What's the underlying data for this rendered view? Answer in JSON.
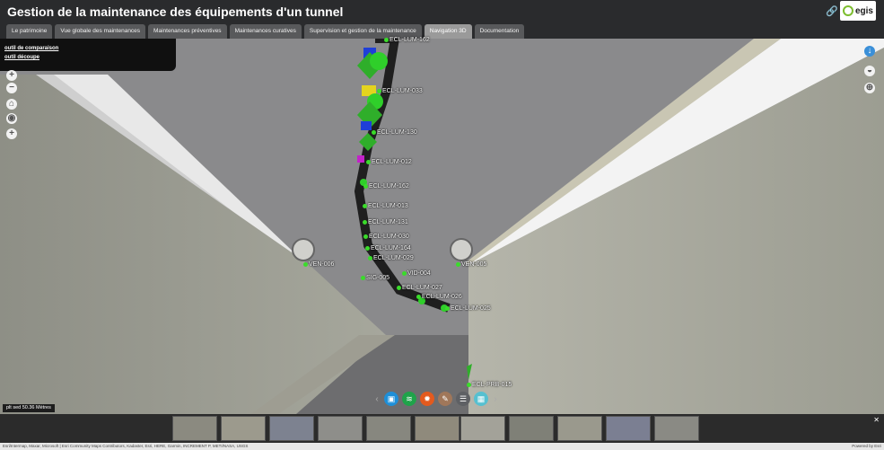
{
  "header": {
    "title": "Gestion de la maintenance des équipements d'un tunnel",
    "logo_text": "egis"
  },
  "tabs": [
    {
      "label": "Le patrimoine"
    },
    {
      "label": "Vue globale des maintenances"
    },
    {
      "label": "Maintenances préventives"
    },
    {
      "label": "Maintenances curatives"
    },
    {
      "label": "Supervision et gestion de la maintenance"
    },
    {
      "label": "Navigation 3D"
    },
    {
      "label": "Documentation"
    }
  ],
  "active_tab": "Navigation 3D",
  "compare_panel": {
    "compare_label": "outil de comparaison",
    "cut_label": "outil découpe"
  },
  "nav_left": {
    "zoom_in": "+",
    "zoom_out": "−",
    "home": "⌂",
    "compass": "◉",
    "add": "+"
  },
  "equipment_labels": [
    {
      "text": "ECL-LUM-162"
    },
    {
      "text": "ECL-LUM-033"
    },
    {
      "text": "ECL-LUM-130"
    },
    {
      "text": "ECL-LUM-012"
    },
    {
      "text": "ECL-LUM-162"
    },
    {
      "text": "ECL-LUM-013"
    },
    {
      "text": "ECL-LUM-131"
    },
    {
      "text": "ECL-LUM-030"
    },
    {
      "text": "ECL-LUM-164"
    },
    {
      "text": "ECL-LUM-029"
    },
    {
      "text": "VEN-006"
    },
    {
      "text": "VEN-005"
    },
    {
      "text": "VID-004"
    },
    {
      "text": "SIG-005"
    },
    {
      "text": "ECL-LUM-027"
    },
    {
      "text": "ECL-LUM-026"
    },
    {
      "text": "ECL-LUM-025"
    },
    {
      "text": "ECL-PRB-015"
    }
  ],
  "scale_text": "plt sed 50.36 Mètres",
  "toolbar_items": [
    "layers-icon",
    "stack-icon",
    "sun-icon",
    "measure-icon",
    "list-icon",
    "grid-icon"
  ],
  "film_close": "✕",
  "footer": {
    "attribution": "Esri/Intermap, Maxar, Microsoft | Esri Community Maps Contributors, Kadaster, Esri, HERE, Garmin, INCREMENT P, METI/NASA, USGS",
    "powered": "Powered by Esri"
  },
  "colors": {
    "header_bg": "#2a2b2d",
    "tab_bg": "#58595b",
    "tab_active": "#9a9a9a",
    "marker_green": "#3adc2a",
    "accent_blue": "#3a8fd8"
  }
}
